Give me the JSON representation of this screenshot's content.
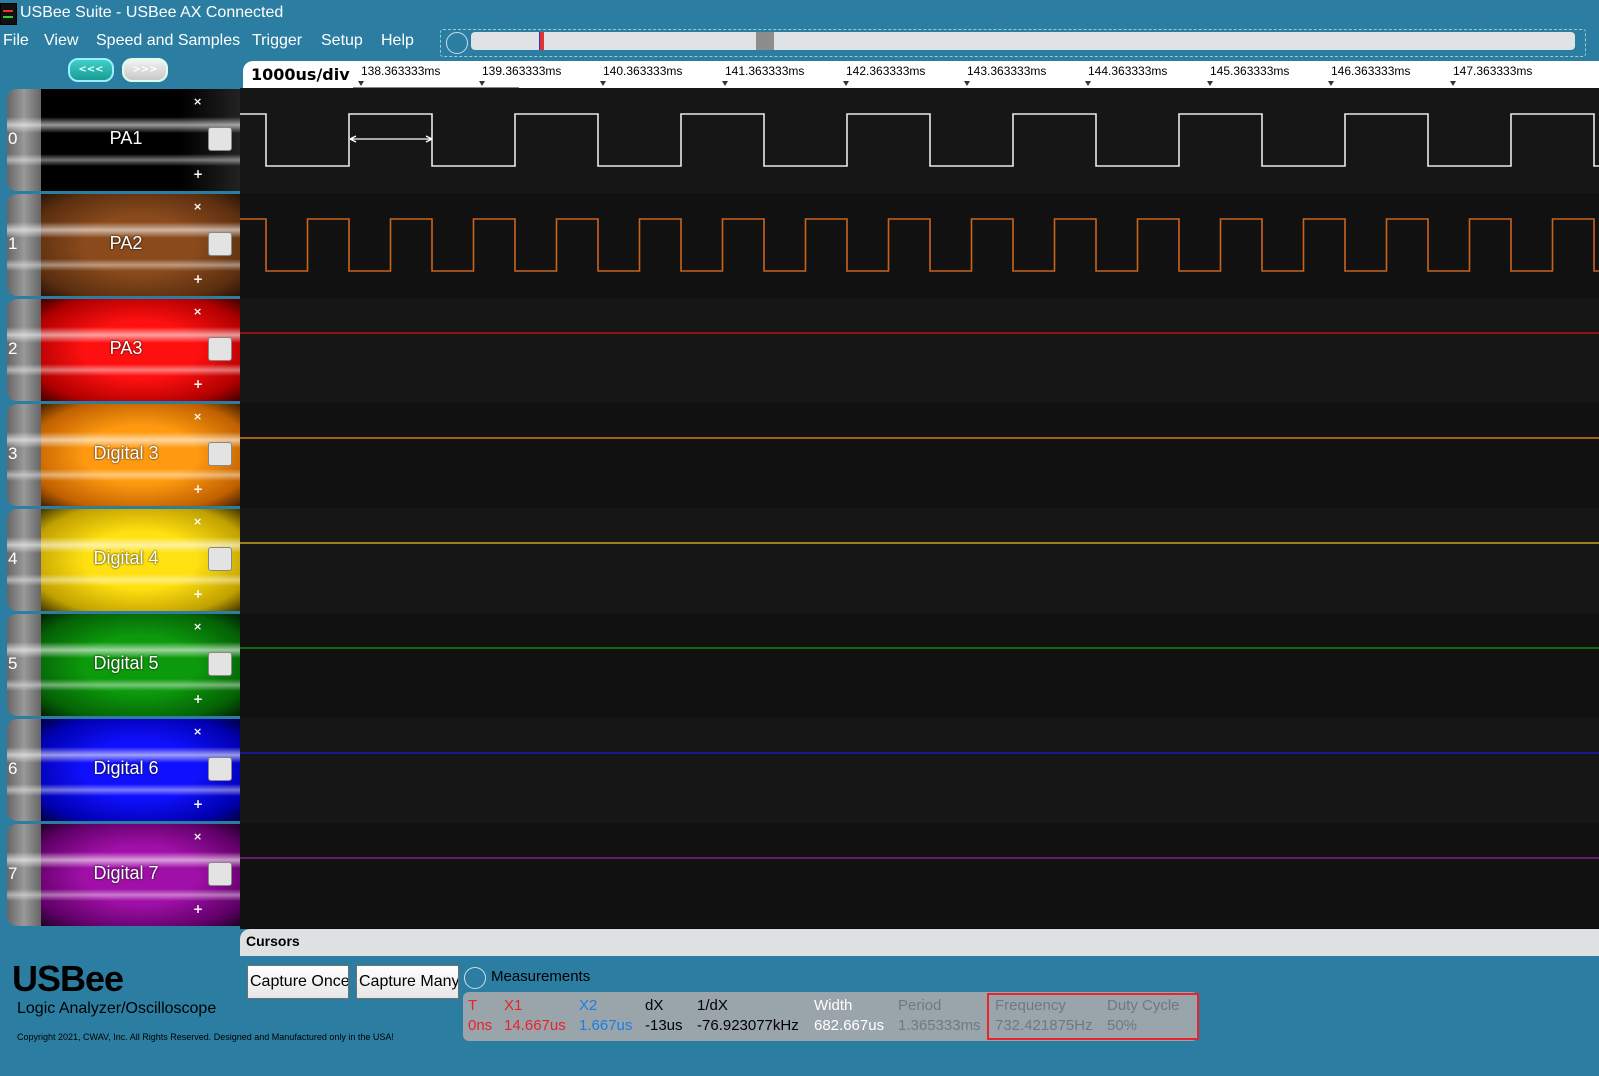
{
  "window": {
    "title": "USBee Suite - USBee AX Connected"
  },
  "menu": [
    "File",
    "View",
    "Speed and Samples",
    "Trigger",
    "Setup",
    "Help"
  ],
  "nav": {
    "prev_label": "<<<",
    "next_label": ">>>"
  },
  "timebar": {
    "scale": "1000us/div",
    "ticks": [
      "138.363333ms",
      "139.363333ms",
      "140.363333ms",
      "141.363333ms",
      "142.363333ms",
      "143.363333ms",
      "144.363333ms",
      "145.363333ms",
      "146.363333ms",
      "147.363333ms"
    ]
  },
  "channels": [
    {
      "index": "0",
      "name": "PA1",
      "color": "#000000",
      "signal": "clock",
      "period_ticks": 2
    },
    {
      "index": "1",
      "name": "PA2",
      "color": "#8a4a1c",
      "signal": "clock",
      "period_ticks": 1
    },
    {
      "index": "2",
      "name": "PA3",
      "color": "#ff0000",
      "signal": "flat"
    },
    {
      "index": "3",
      "name": "Digital 3",
      "color": "#ff8c00",
      "signal": "flat"
    },
    {
      "index": "4",
      "name": "Digital 4",
      "color": "#ffd700",
      "signal": "flat"
    },
    {
      "index": "5",
      "name": "Digital 5",
      "color": "#008000",
      "signal": "flat"
    },
    {
      "index": "6",
      "name": "Digital 6",
      "color": "#0000ff",
      "signal": "flat"
    },
    {
      "index": "7",
      "name": "Digital 7",
      "color": "#8b008b",
      "signal": "flat"
    }
  ],
  "cursors": {
    "label": "Cursors"
  },
  "brand": {
    "logo": "USBee",
    "tagline": "Logic Analyzer/Oscilloscope",
    "copyright": "Copyright 2021, CWAV, Inc. All Rights Reserved. Designed and Manufactured only in the USA!"
  },
  "buttons": {
    "capture_once": "Capture Once",
    "capture_many": "Capture Many"
  },
  "measurements": {
    "label": "Measurements",
    "T": {
      "header": "T",
      "value": "0ns"
    },
    "X1": {
      "header": "X1",
      "value": "14.667us"
    },
    "X2": {
      "header": "X2",
      "value": "1.667us"
    },
    "dX": {
      "header": "dX",
      "value": "-13us"
    },
    "inv_dX": {
      "header": "1/dX",
      "value": "-76.923077kHz"
    },
    "width": {
      "header": "Width",
      "value": "682.667us"
    },
    "period": {
      "header": "Period",
      "value": "1.365333ms"
    },
    "frequency": {
      "header": "Frequency",
      "value": "732.421875Hz"
    },
    "duty_cycle": {
      "header": "Duty Cycle",
      "value": "50%"
    }
  },
  "colors": {
    "accent_red": "#e8232b",
    "x1_red": "#e8232b",
    "x2_blue": "#1a7fe0",
    "inactive_grey": "#6e7a82"
  }
}
